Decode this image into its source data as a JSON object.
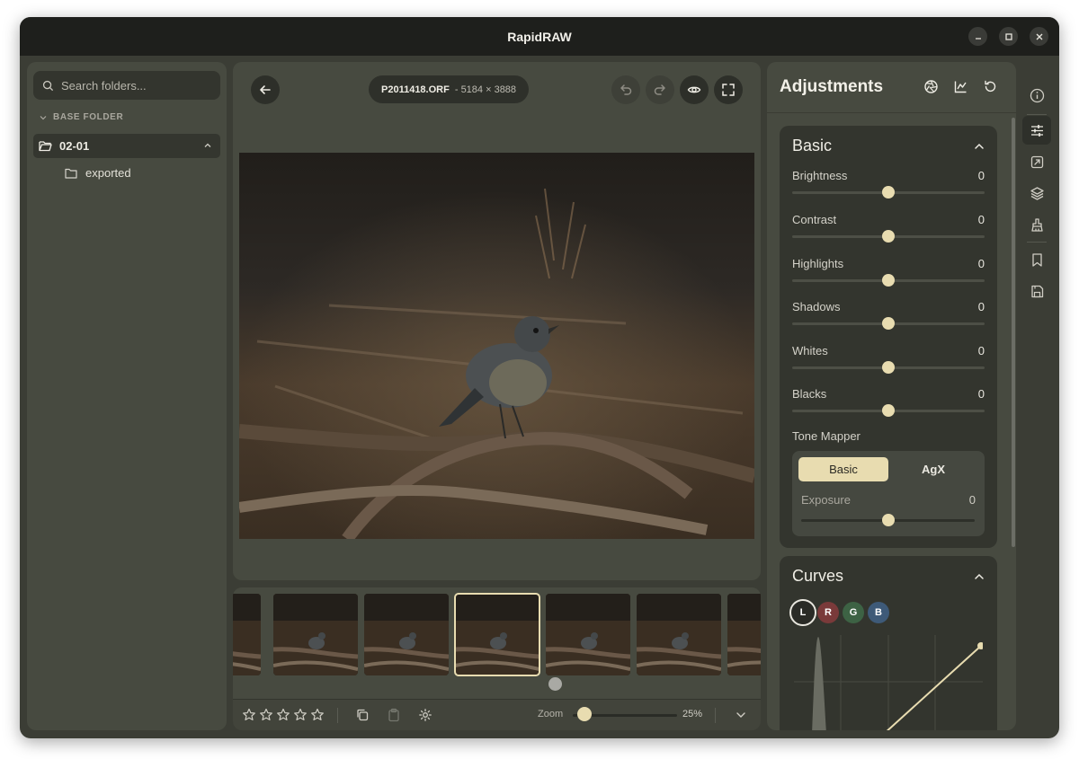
{
  "window": {
    "title": "RapidRAW"
  },
  "left_panel": {
    "search_placeholder": "Search folders...",
    "base_folder_label": "BASE FOLDER",
    "folder_name": "02-01",
    "subfolders": [
      "exported"
    ]
  },
  "viewer": {
    "file_name": "P2011418.ORF",
    "file_dimensions": "- 5184 × 3888"
  },
  "bottom_bar": {
    "rating_stars": 5,
    "zoom_label": "Zoom",
    "zoom_value": "25%",
    "zoom_fraction": 0.1
  },
  "adjustments": {
    "title": "Adjustments",
    "basic": {
      "title": "Basic",
      "sliders": [
        {
          "label": "Brightness",
          "value": "0"
        },
        {
          "label": "Contrast",
          "value": "0"
        },
        {
          "label": "Highlights",
          "value": "0"
        },
        {
          "label": "Shadows",
          "value": "0"
        },
        {
          "label": "Whites",
          "value": "0"
        },
        {
          "label": "Blacks",
          "value": "0"
        }
      ],
      "tone_mapper_label": "Tone Mapper",
      "tone_mapper_options": [
        "Basic",
        "AgX"
      ],
      "tone_mapper_selected": "Basic",
      "exposure_label": "Exposure",
      "exposure_value": "0"
    },
    "curves": {
      "title": "Curves",
      "channels": [
        "L",
        "R",
        "G",
        "B"
      ],
      "selected_channel": "L"
    }
  },
  "colors": {
    "accent": "#e8dcb0",
    "window_bg": "#3b3d35",
    "panel_bg": "#474a40",
    "card_bg": "#33352e",
    "titlebar_bg": "#1e1f1c"
  },
  "icons": {
    "rail": [
      "info-icon",
      "sliders-icon",
      "export-icon",
      "layers-icon",
      "brush-icon",
      "bookmark-icon",
      "save-icon"
    ],
    "adjustment_header": [
      "aperture-icon",
      "histogram-icon",
      "reset-icon"
    ]
  }
}
